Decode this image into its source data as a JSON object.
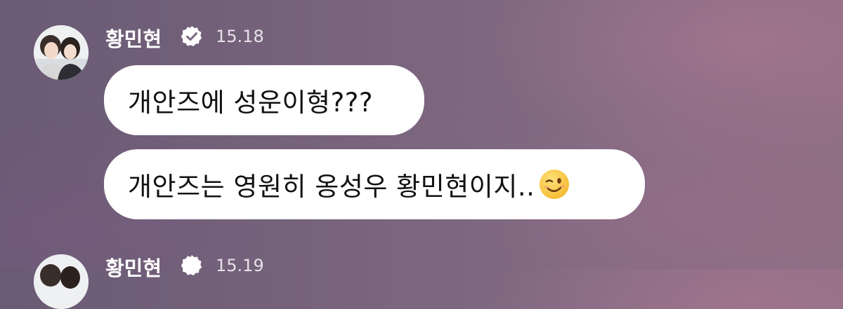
{
  "messages": [
    {
      "sender": "황민현",
      "time": "15.18",
      "verified_icon": "verified-badge-icon",
      "avatar_icon": "profile-photo-avatar",
      "bubbles": [
        {
          "text": "개안즈에 성운이형???"
        },
        {
          "text": "개안즈는 영원히 옹성우 황민현이지..",
          "emoji": "winking-face-icon"
        }
      ]
    },
    {
      "sender": "황민현",
      "time": "15.19",
      "verified_icon": "verified-badge-icon",
      "avatar_icon": "profile-photo-avatar"
    }
  ],
  "colors": {
    "bubble_background": "#ffffff",
    "bubble_text": "#111111",
    "name_text": "#ffffff",
    "background_left": "#6a5a74",
    "background_right": "#8e6f85"
  }
}
